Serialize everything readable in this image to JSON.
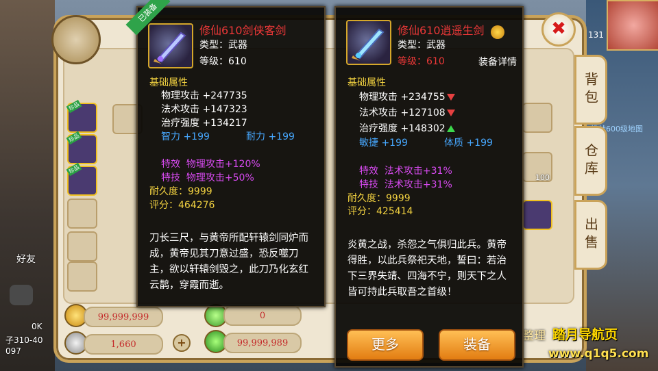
{
  "tooltip_left": {
    "equipped_label": "已装备",
    "name": "修仙610剑侠客剑",
    "type_line": "类型：武器",
    "level_line": "等级：610",
    "base_header": "基础属性",
    "stats": [
      {
        "label": "物理攻击",
        "value": "+247735"
      },
      {
        "label": "法术攻击",
        "value": "+147323"
      },
      {
        "label": "治疗强度",
        "value": "+134217"
      }
    ],
    "extra_stats": [
      {
        "label": "智力",
        "value": "+199"
      },
      {
        "label": "耐力",
        "value": "+199"
      }
    ],
    "effects": [
      {
        "label": "特效",
        "value": "物理攻击+120%"
      },
      {
        "label": "特技",
        "value": "物理攻击+50%"
      }
    ],
    "durability": "耐久度：9999",
    "score": "评分：464276",
    "description": "刀长三尺，与黄帝所配轩辕剑同炉而成，黄帝见其刀意过盛，恐反噬刀主，欲以轩辕剑毁之，此刀乃化玄红云鹊，穿霞而逝。"
  },
  "tooltip_right": {
    "name": "修仙610逍遥生剑",
    "type_line": "类型：武器",
    "level_label": "等级：",
    "level_value": "610",
    "detail_label": "装备详情",
    "base_header": "基础属性",
    "stats": [
      {
        "label": "物理攻击",
        "value": "+234755",
        "trend": "down"
      },
      {
        "label": "法术攻击",
        "value": "+127108",
        "trend": "down"
      },
      {
        "label": "治疗强度",
        "value": "+148302",
        "trend": "up"
      }
    ],
    "extra_stats": [
      {
        "label": "敏捷",
        "value": "+199"
      },
      {
        "label": "体质",
        "value": "+199"
      }
    ],
    "effects": [
      {
        "label": "特效",
        "value": "法术攻击+31%"
      },
      {
        "label": "特技",
        "value": "法术攻击+31%"
      }
    ],
    "durability": "耐久度：9999",
    "score": "评分：425414",
    "description": "炎黄之战，杀怨之气俱归此兵。黄帝得胜，以此兵祭祀天地，誓曰：若治下三界失靖、四海不宁，则天下之人皆可持此兵取吾之首级！",
    "more_button": "更多",
    "equip_button": "装备"
  },
  "bag": {
    "tabs": [
      "背包",
      "仓库",
      "出售"
    ],
    "sort_label": "整理",
    "friends_label": "好友",
    "currencies": [
      "99,999,999",
      "0",
      "1,660",
      "99,999,989"
    ],
    "rare_tags": [
      "珍品",
      "珍品",
      "珍品"
    ],
    "slot_count": "100",
    "map_text": "挑战600级地图",
    "top_right_number": "131",
    "left_side_lines": [
      "0K",
      "子310-40",
      "097"
    ]
  },
  "watermark": {
    "line1": "踏月导航页",
    "line2": "www.q1q5.com"
  },
  "colors": {
    "stat_yellow": "#f0d040",
    "name_red": "#ee3838",
    "attr_blue": "#47a8ff",
    "effect_purple": "#d74af0",
    "button_orange": "#f0a030"
  }
}
